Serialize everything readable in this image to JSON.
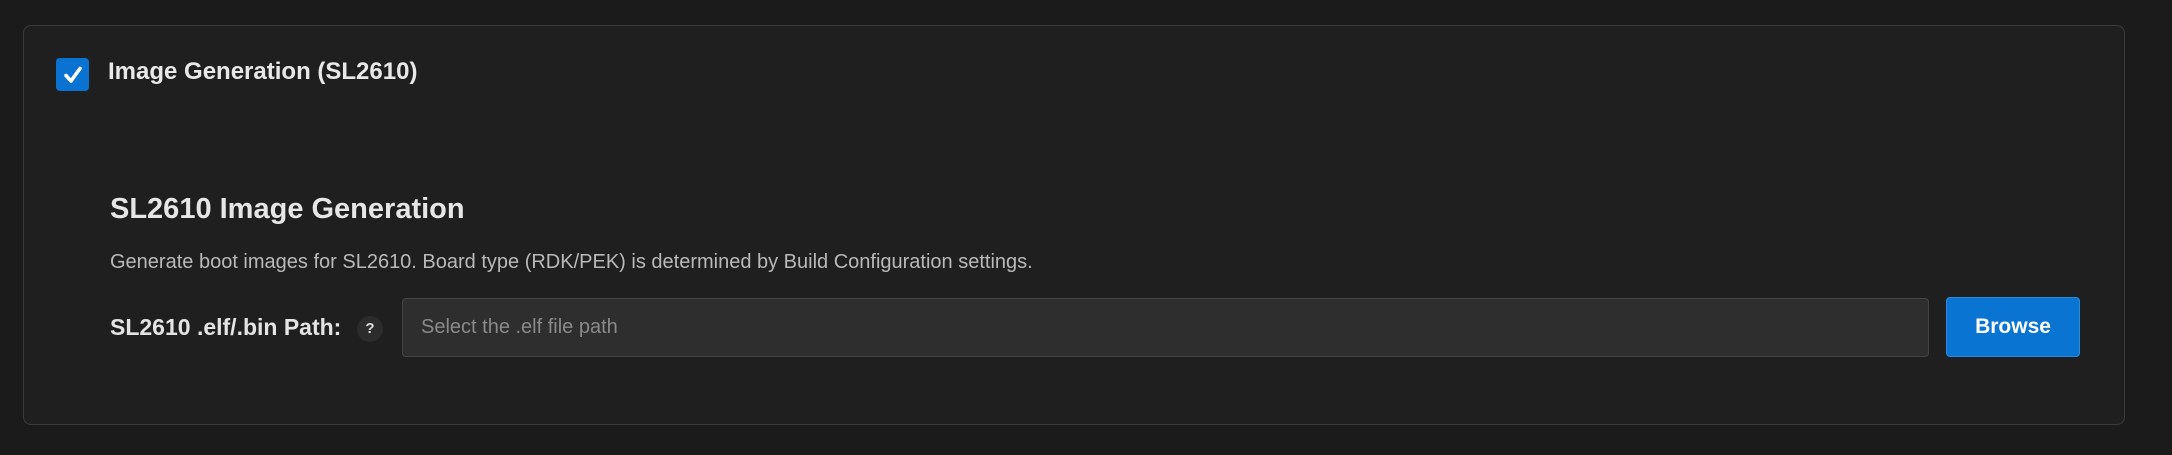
{
  "section": {
    "title": "Image Generation (SL2610)",
    "enabled": true,
    "check_icon": "checkmark-icon",
    "accent_color": "#0a73d1"
  },
  "content": {
    "heading": "SL2610 Image Generation",
    "description": "Generate boot images for SL2610. Board type (RDK/PEK) is determined by Build Configuration settings.",
    "path_label": "SL2610 .elf/.bin Path:",
    "help_icon": "?",
    "path_input": {
      "value": "",
      "placeholder": "Select the .elf file path"
    },
    "browse_label": "Browse"
  }
}
